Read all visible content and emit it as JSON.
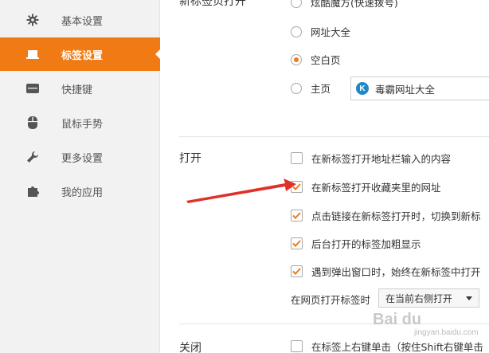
{
  "sidebar": {
    "items": [
      {
        "label": "基本设置",
        "icon": "gear-icon"
      },
      {
        "label": "标签设置",
        "icon": "tab-icon",
        "active": true
      },
      {
        "label": "快捷键",
        "icon": "keyboard-icon"
      },
      {
        "label": "鼠标手势",
        "icon": "mouse-icon"
      },
      {
        "label": "更多设置",
        "icon": "wrench-icon"
      },
      {
        "label": "我的应用",
        "icon": "puzzle-icon"
      }
    ]
  },
  "new_tab": {
    "label": "新标签页打开",
    "options": [
      {
        "label": "炫酷魔方(快速拨号)",
        "selected": false
      },
      {
        "label": "网址大全",
        "selected": false
      },
      {
        "label": "空白页",
        "selected": true
      },
      {
        "label": "主页",
        "selected": false
      }
    ],
    "homepage_value": "毒霸网址大全"
  },
  "open": {
    "label": "打开",
    "checks": [
      {
        "label": "在新标签打开地址栏输入的内容",
        "checked": false
      },
      {
        "label": "在新标签打开收藏夹里的网址",
        "checked": true
      },
      {
        "label": "点击链接在新标签打开时，切换到新标",
        "checked": true
      },
      {
        "label": "后台打开的标签加粗显示",
        "checked": true
      },
      {
        "label": "遇到弹出窗口时，始终在新标签中打开",
        "checked": true
      }
    ],
    "position_label": "在网页打开标签时",
    "position_value": "在当前右侧打开"
  },
  "close": {
    "label": "关闭",
    "checks": [
      {
        "label": "在标签上右键单击（按住Shift右键单击",
        "checked": false
      }
    ]
  },
  "colors": {
    "accent": "#f07a14",
    "arrow": "#e0302a"
  },
  "watermark": {
    "text": "Bai du",
    "sub": "jingyan.baidu.com"
  }
}
